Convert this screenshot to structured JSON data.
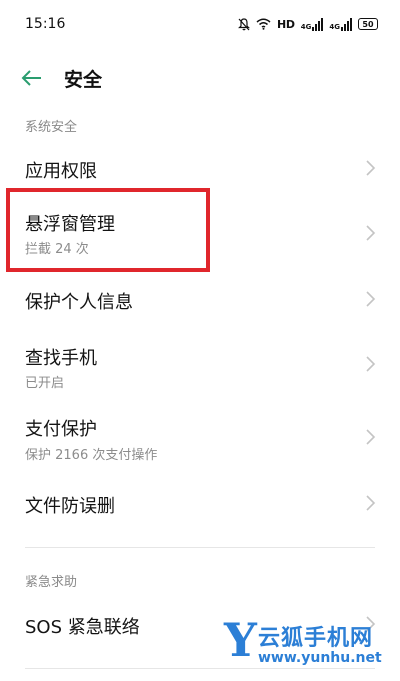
{
  "status_bar": {
    "time": "15:16",
    "network_label": "HD",
    "signal_1_label": "4G",
    "signal_2_label": "4G",
    "battery": "50",
    "icons": [
      "mute-bell-icon",
      "wifi-icon",
      "signal-icon",
      "signal-icon",
      "battery-icon"
    ]
  },
  "header": {
    "title": "安全",
    "back_icon": "back-arrow-icon"
  },
  "sections": {
    "system_security": {
      "label": "系统安全",
      "items": [
        {
          "title": "应用权限",
          "subtitle": ""
        },
        {
          "title": "悬浮窗管理",
          "subtitle": "拦截 24 次"
        },
        {
          "title": "保护个人信息",
          "subtitle": ""
        },
        {
          "title": "查找手机",
          "subtitle": "已开启"
        },
        {
          "title": "支付保护",
          "subtitle": "保护 2166 次支付操作"
        },
        {
          "title": "文件防误删",
          "subtitle": ""
        }
      ]
    },
    "emergency": {
      "label": "紧急求助",
      "items": [
        {
          "title": "SOS 紧急联络",
          "subtitle": ""
        }
      ]
    }
  },
  "watermark": {
    "letter": "Y",
    "brand": "云狐手机网",
    "url": "www.yunhu.net"
  },
  "colors": {
    "accent_green": "#2a9d6f",
    "highlight_red": "#e0262c",
    "watermark_blue": "#2c7fd6"
  }
}
